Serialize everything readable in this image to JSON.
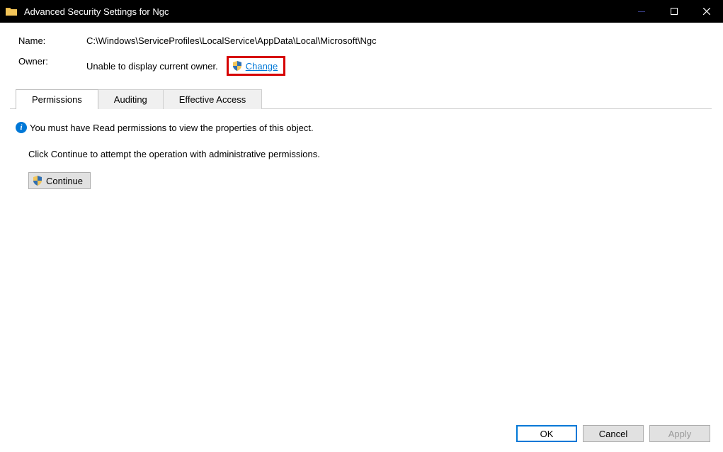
{
  "titlebar": {
    "title": "Advanced Security Settings for Ngc"
  },
  "fields": {
    "name_label": "Name:",
    "name_value": "C:\\Windows\\ServiceProfiles\\LocalService\\AppData\\Local\\Microsoft\\Ngc",
    "owner_label": "Owner:",
    "owner_value": "Unable to display current owner.",
    "change_link": "Change"
  },
  "tabs": {
    "permissions": "Permissions",
    "auditing": "Auditing",
    "effective_access": "Effective Access"
  },
  "body": {
    "info_i": "i",
    "perm_note": "You must have Read permissions to view the properties of this object.",
    "instruction": "Click Continue to attempt the operation with administrative permissions.",
    "continue_label": "Continue"
  },
  "footer": {
    "ok": "OK",
    "cancel": "Cancel",
    "apply": "Apply"
  }
}
